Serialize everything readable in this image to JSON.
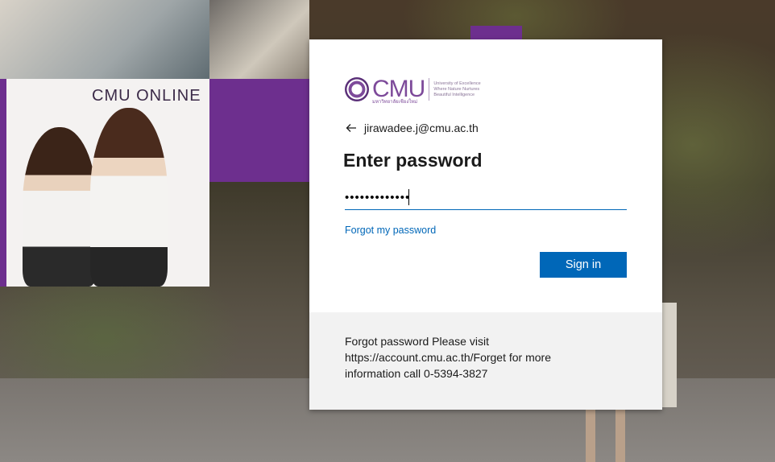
{
  "banner": {
    "title": "CMU ONLINE"
  },
  "logo": {
    "text": "CMU",
    "thai_subtitle": "มหาวิทยาลัยเชียงใหม่",
    "tagline_lines": [
      "University of Excellence",
      "Where Nature Nurtures",
      "Beautiful Intelligence"
    ]
  },
  "identity": {
    "email": "jirawadee.j@cmu.ac.th"
  },
  "form": {
    "title": "Enter password",
    "password_value": "•••••••••••••",
    "forgot_link": "Forgot my password",
    "signin_label": "Sign in"
  },
  "footer": {
    "line1": "Forgot password Please visit",
    "line2": "https://account.cmu.ac.th/Forget for more",
    "line3": "information call 0-5394-3827"
  },
  "colors": {
    "accent": "#0067b8",
    "brand_purple": "#6d2f8e",
    "footer_bg": "#f2f2f2"
  }
}
